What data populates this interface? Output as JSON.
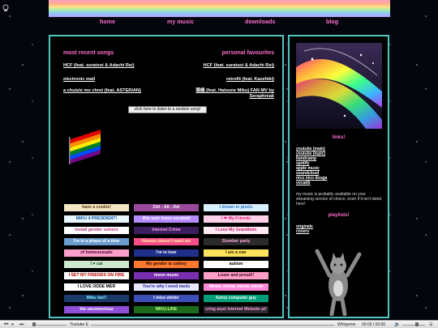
{
  "nav": {
    "home": "home",
    "my_music": "my music",
    "downloads": "downloads",
    "blog": "blog"
  },
  "main": {
    "recent_title": "most recent songs",
    "favourites_title": "personal favourites",
    "recent_songs": [
      "HCF (feat. suratsoi & Adachi Rei)",
      "electronic mail",
      "a chuisle mo chroi (feat. ASTERIAN)"
    ],
    "favourite_songs": [
      "HCF (feat. suratsoi & Adachi Rei)",
      "retrofit (feat. Kazehiki)",
      "頭痛 (feat. Hatsune Miku) FAN MV by Seraphreak"
    ],
    "random_button": "click here to listen to a random song!",
    "buttons": [
      {
        "text": "have a cookie!",
        "bg": "#f3e6c2",
        "fg": "#5a3a10"
      },
      {
        "text": "Ctrl - Alt - Del",
        "bg": "#9b4a9b",
        "fg": "#ffffff"
      },
      {
        "text": "I dream in pixels",
        "bg": "#d8f0ff",
        "fg": "#3070c0"
      },
      {
        "text": "MIKU 4 PRESIDENT!",
        "bg": "#e9f7ff",
        "fg": "#0e55a8"
      },
      {
        "text": "this user loves vocaloid",
        "bg": "#b48cff",
        "fg": "#ffffff"
      },
      {
        "text": "I ❤ My Friends",
        "bg": "#ffd2ea",
        "fg": "#e0207a"
      },
      {
        "text": "install gender solvers",
        "bg": "#ffffff",
        "fg": "#c03080"
      },
      {
        "text": "Internet Crime",
        "bg": "#3b1f5e",
        "fg": "#ff9de8"
      },
      {
        "text": "I Love My Grandkids",
        "bg": "#ffe9f4",
        "fg": "#c02070"
      },
      {
        "text": "I'm in a phase of a time",
        "bg": "#6a9ccf",
        "fg": "#ffffff"
      },
      {
        "text": "Heaven doesn't want me",
        "bg": "#ff4f8a",
        "fg": "#fff3a0"
      },
      {
        "text": "Slumber party",
        "bg": "#2b2b2b",
        "fg": "#ffa5d8"
      },
      {
        "text": "of homosexuals",
        "bg": "#ff9ec8",
        "fg": "#3b0b2e"
      },
      {
        "text": "I'm in love",
        "bg": "#1f2f8a",
        "fg": "#ffffff"
      },
      {
        "text": "I am a star",
        "bg": "#ffe35c",
        "fg": "#3b2a00"
      },
      {
        "text": "I ♥ cat",
        "bg": "#cfe9cf",
        "fg": "#1f4f1f"
      },
      {
        "text": "My gender is catboy",
        "bg": "#ff7a2f",
        "fg": "#2b0b00"
      },
      {
        "text": "autism",
        "bg": "#ffffff",
        "fg": "#000000"
      },
      {
        "text": "I SET MY FRIENDS ON FIRE",
        "bg": "#ffffff",
        "fg": "#c00000"
      },
      {
        "text": "moon music",
        "bg": "#7a2fb0",
        "fg": "#ffffff"
      },
      {
        "text": "Loser and proud!!",
        "bg": "#ff9ec8",
        "fg": "#400020"
      },
      {
        "text": "I LOVE ODDE MER",
        "bg": "#ffffff",
        "fg": "#000000"
      },
      {
        "text": "You're why I need meds",
        "bg": "#e8e8ff",
        "fg": "#2020a0"
      },
      {
        "text": "Meow, meow, meow, meow",
        "bg": "#ff8ad8",
        "fg": "#ffffff"
      },
      {
        "text": "Miku fan!!",
        "bg": "#1d3b6a",
        "fg": "#7ff7ff"
      },
      {
        "text": "I miss winter",
        "bg": "#3c4fb8",
        "fg": "#ffffff"
      },
      {
        "text": "funny computer guy",
        "bg": "#00a07a",
        "fg": "#ffffff"
      },
      {
        "text": "the unconscious",
        "bg": "#8f4fd8",
        "fg": "#ffffff"
      },
      {
        "text": "MIKU-LINE",
        "bg": "#1c6b1c",
        "fg": "#b6ff7a"
      },
      {
        "text": "cring aiya! Internet Website pt!",
        "bg": "#2a2a2a",
        "fg": "#ff9de8"
      }
    ]
  },
  "side": {
    "links_title": "links!",
    "links": [
      "youtube (main)",
      "youtube (topic)",
      "bandcamp",
      "spotify",
      "apple music",
      "soundcloud",
      "nico nico douga",
      "vocadb"
    ],
    "note": "my music is probably available on your streaming service of choice, even if it isn't listed here!",
    "playlists_title": "playlists!",
    "playlists": [
      "originals",
      "covers"
    ]
  },
  "player": {
    "source": "Youtube E",
    "title": "Whisperer",
    "time": "00:00 / 00:00"
  }
}
